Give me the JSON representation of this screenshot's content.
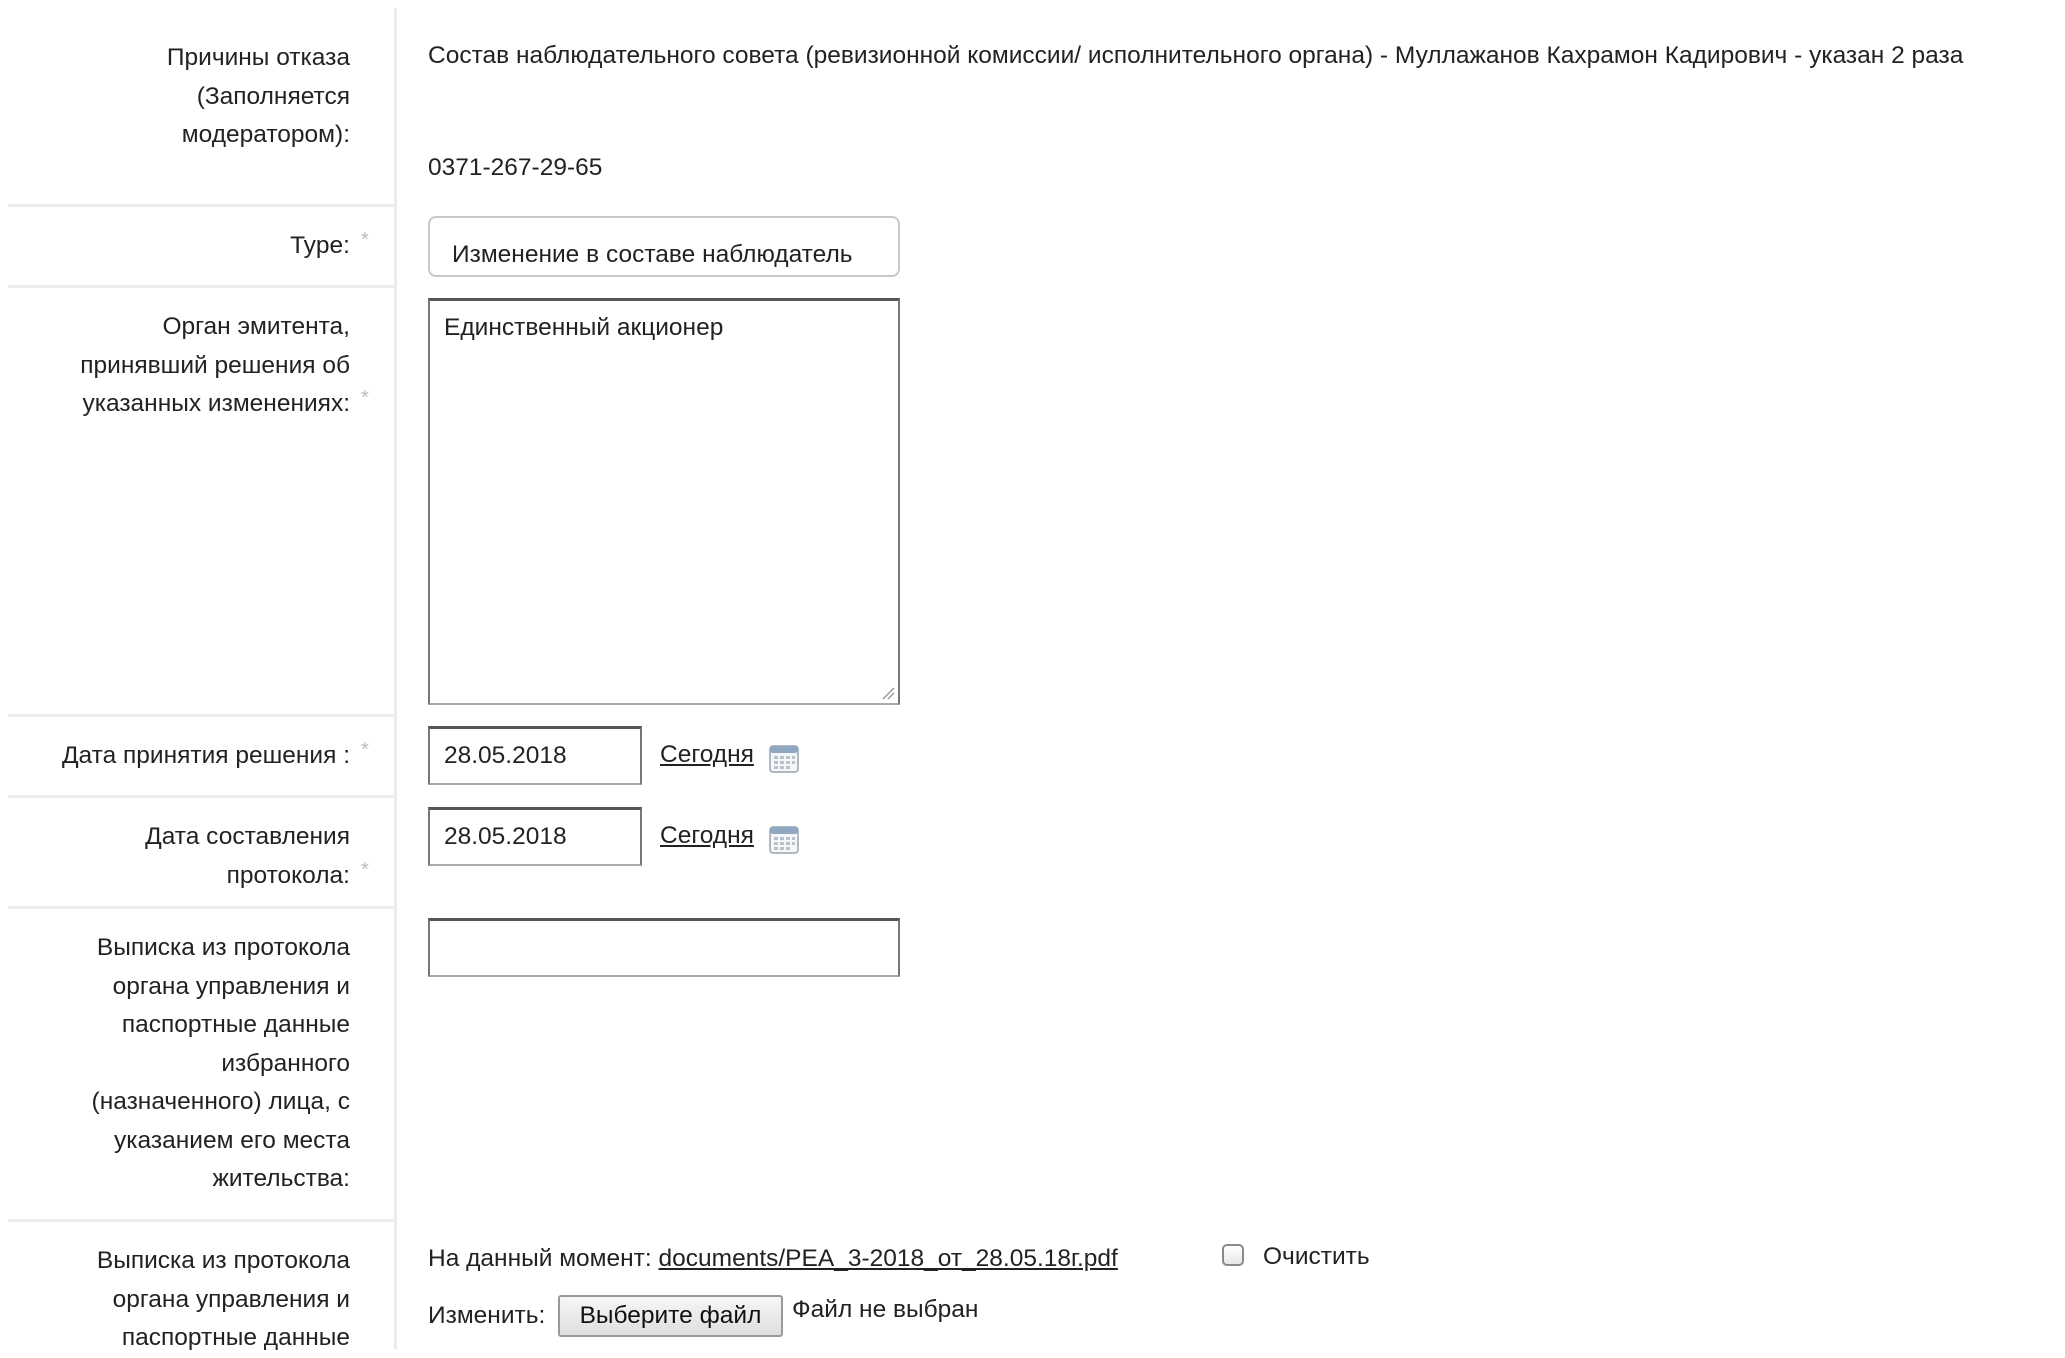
{
  "rows": {
    "reject_reasons": {
      "label": [
        "Причины отказа",
        "(Заполняется",
        "модератором):"
      ],
      "value": "Состав наблюдательного совета (ревизионной комиссии/ исполнительного органа) - Муллажанов Кахрамон Кадирович - указан 2 раза",
      "phone": "0371-267-29-65"
    },
    "type": {
      "label": "Type:",
      "required_mark": "*",
      "selected": "Изменение в составе наблюдатель"
    },
    "organ": {
      "label": [
        "Орган эмитента,",
        "принявший решения об",
        "указанных изменениях:"
      ],
      "required_mark": "*",
      "value": "Единственный акционер"
    },
    "decision_date": {
      "label": "Дата принятия решения :",
      "required_mark": "*",
      "value": "28.05.2018",
      "today_link": "Сегодня",
      "icon": "calendar-icon"
    },
    "protocol_date": {
      "label": [
        "Дата составления",
        "протокола:"
      ],
      "required_mark": "*",
      "value": "28.05.2018",
      "today_link": "Сегодня",
      "icon": "calendar-icon"
    },
    "extract_text": {
      "label": [
        "Выписка из протокола",
        "органа управления и",
        "паспортные данные",
        "избранного",
        "(назначенного) лица, с",
        "указанием его места",
        "жительства:"
      ],
      "value": ""
    },
    "extract_file": {
      "label": [
        "Выписка из протокола",
        "органа управления и",
        "паспортные данные"
      ],
      "current_prefix": "На данный момент:",
      "current_file": "documents/PEA_3-2018_от_28.05.18г.pdf",
      "clear_label": "Очистить",
      "change_label": "Изменить:",
      "choose_button": "Выберите файл",
      "no_file": "Файл не выбран"
    }
  },
  "colors": {
    "text": "#222222",
    "required": "#bbbbbb",
    "divider": "#ececec",
    "background": "#ffffff"
  }
}
